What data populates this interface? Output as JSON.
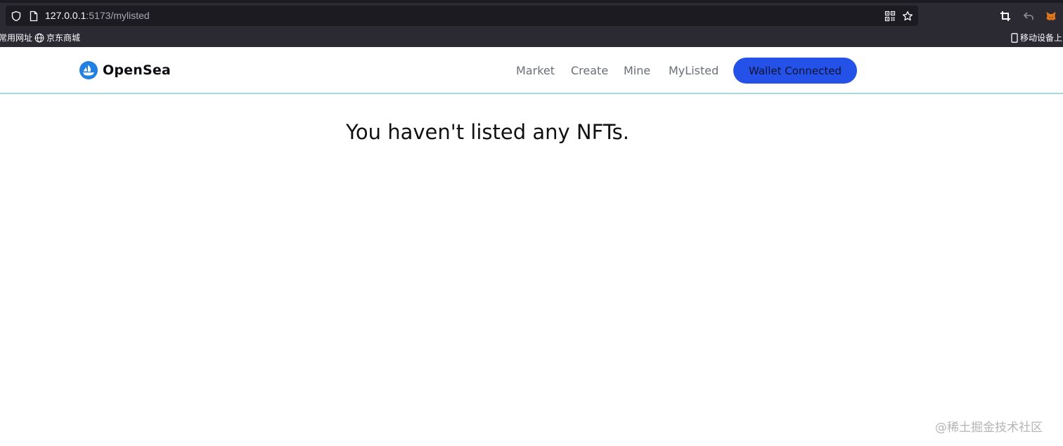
{
  "browser": {
    "url_host": "127.0.0.1",
    "url_rest": ":5173/mylisted",
    "bookmarks": [
      {
        "label": "常用网址",
        "icon": "none"
      },
      {
        "label": "京东商城",
        "icon": "globe-icon"
      }
    ],
    "mobile_bookmarks": "移动设备上的"
  },
  "header": {
    "brand": "OpenSea",
    "nav": [
      {
        "label": "Market"
      },
      {
        "label": "Create"
      },
      {
        "label": "Mine"
      },
      {
        "label": "MyListed"
      }
    ],
    "wallet_button": "Wallet Connected"
  },
  "main": {
    "empty_message": "You haven't listed any NFTs."
  },
  "watermark": "@稀土掘金技术社区",
  "colors": {
    "accent": "#2452e8",
    "brand_logo": "#2081e2",
    "header_border": "#a9d6df",
    "chrome_bg": "#2b2a33"
  }
}
